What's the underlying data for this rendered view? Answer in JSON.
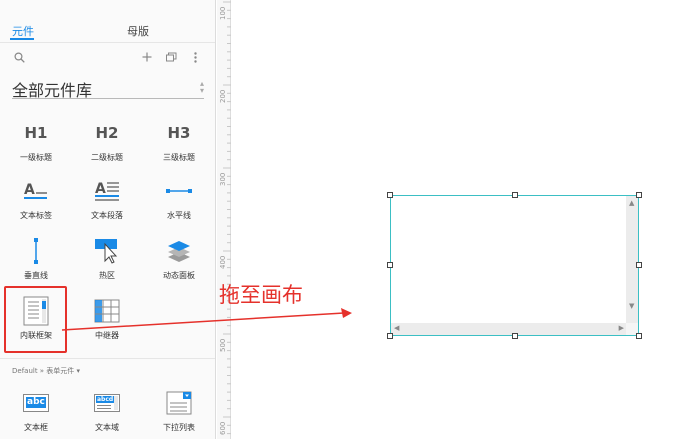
{
  "panel": {
    "tabs": [
      {
        "label": "元件",
        "active": true
      },
      {
        "label": "母版",
        "active": false
      }
    ],
    "tools": {
      "search_icon": "search-icon",
      "add_icon": "plus-icon",
      "library_icon": "library-icon",
      "menu_icon": "more-icon"
    },
    "library_select": {
      "value": "全部元件库"
    },
    "widgets": [
      {
        "label": "一级标题",
        "icon": "H1"
      },
      {
        "label": "二级标题",
        "icon": "H2"
      },
      {
        "label": "三级标题",
        "icon": "H3"
      },
      {
        "label": "文本标签",
        "icon": "text-label-icon"
      },
      {
        "label": "文本段落",
        "icon": "text-paragraph-icon"
      },
      {
        "label": "水平线",
        "icon": "horizontal-line-icon"
      },
      {
        "label": "垂直线",
        "icon": "vertical-line-icon"
      },
      {
        "label": "热区",
        "icon": "hotspot-icon"
      },
      {
        "label": "动态面板",
        "icon": "dynamic-panel-icon"
      },
      {
        "label": "内联框架",
        "icon": "inline-frame-icon"
      },
      {
        "label": "中继器",
        "icon": "repeater-icon"
      }
    ],
    "section_title": "Default » 表单元件 ▾",
    "form_widgets": [
      {
        "label": "文本框",
        "icon": "textbox-icon",
        "icon_text": "abc"
      },
      {
        "label": "文本域",
        "icon": "textarea-icon",
        "icon_text": "abcd"
      },
      {
        "label": "下拉列表",
        "icon": "dropdown-icon"
      }
    ]
  },
  "ruler": {
    "labels": [
      "100",
      "200",
      "300",
      "400",
      "500",
      "600"
    ]
  },
  "canvas": {
    "annotation": "拖至画布",
    "accent_color": "#e5312b",
    "frame_border_color": "#3bbfc4"
  }
}
